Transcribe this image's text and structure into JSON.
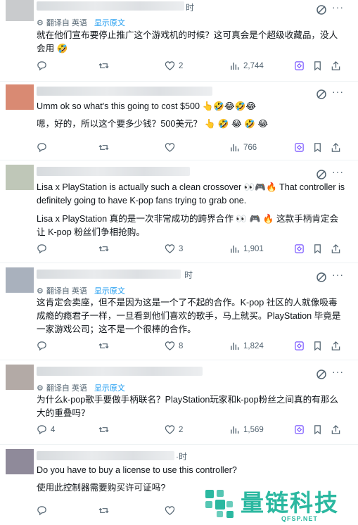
{
  "tweets": [
    {
      "avatar_color": "#c9cbcd",
      "time": "时",
      "translation": {
        "label": "翻译自 英语",
        "show_original": "显示原文"
      },
      "lines": [
        "就在他们宣布要停止推广这个游戏机的时候？这可真会是个超级收藏品，没人会用 🤣"
      ],
      "replies": "",
      "retweets": "",
      "likes": "2",
      "views": "2,744"
    },
    {
      "avatar_color": "#d98a73",
      "time": "",
      "translation": null,
      "lines": [
        "Umm ok so what's this going to cost $500 👆🤣😂🤣😂",
        "嗯，好的，所以这个要多少钱？500美元？ 👆 🤣 😂 🤣 😂"
      ],
      "replies": "",
      "retweets": "",
      "likes": "",
      "views": "766"
    },
    {
      "avatar_color": "#bfc7b8",
      "time": "",
      "translation": null,
      "lines": [
        "Lisa x PlayStation is actually such a clean crossover 👀🎮🔥 That controller is definitely going to have K-pop fans trying to grab one.",
        "Lisa x PlayStation 真的是一次非常成功的跨界合作 👀 🎮 🔥 这款手柄肯定会让 K-pop 粉丝们争相抢购。"
      ],
      "replies": "",
      "retweets": "",
      "likes": "3",
      "views": "1,901"
    },
    {
      "avatar_color": "#a9b1bd",
      "time": "时",
      "translation": {
        "label": "翻译自 英语",
        "show_original": "显示原文"
      },
      "lines": [
        "这肯定会卖座，但不是因为这是一个了不起的合作。K-pop 社区的人就像吸毒成瘾的瘾君子一样，一旦看到他们喜欢的歌手，马上就买。PlayStation 毕竟是一家游戏公司；这不是一个很棒的合作。"
      ],
      "replies": "",
      "retweets": "",
      "likes": "8",
      "views": "1,824"
    },
    {
      "avatar_color": "#b3aaa6",
      "time": "",
      "translation": {
        "label": "翻译自 英语",
        "show_original": "显示原文"
      },
      "lines": [
        "为什么k-pop歌手要做手柄联名？PlayStation玩家和k-pop粉丝之间真的有那么大的重叠吗？"
      ],
      "replies": "4",
      "retweets": "",
      "likes": "2",
      "views": "1,569"
    },
    {
      "avatar_color": "#8f8a9a",
      "time": "·时",
      "translation": null,
      "lines": [
        "Do you have to buy a license to use this controller?",
        "使用此控制器需要购买许可证吗?"
      ],
      "replies": "",
      "retweets": "",
      "likes": "",
      "views": ""
    }
  ],
  "watermark": {
    "title": "量链科技",
    "subtitle": "QFSP.NET",
    "color": "#2bb8a0"
  },
  "icons": {
    "reply": "reply-icon",
    "retweet": "retweet-icon",
    "like": "heart-icon",
    "views": "views-icon",
    "grok": "grok-icon",
    "bookmark": "bookmark-icon",
    "share": "share-icon",
    "more": "more-icon",
    "translate": "translate-icon"
  }
}
